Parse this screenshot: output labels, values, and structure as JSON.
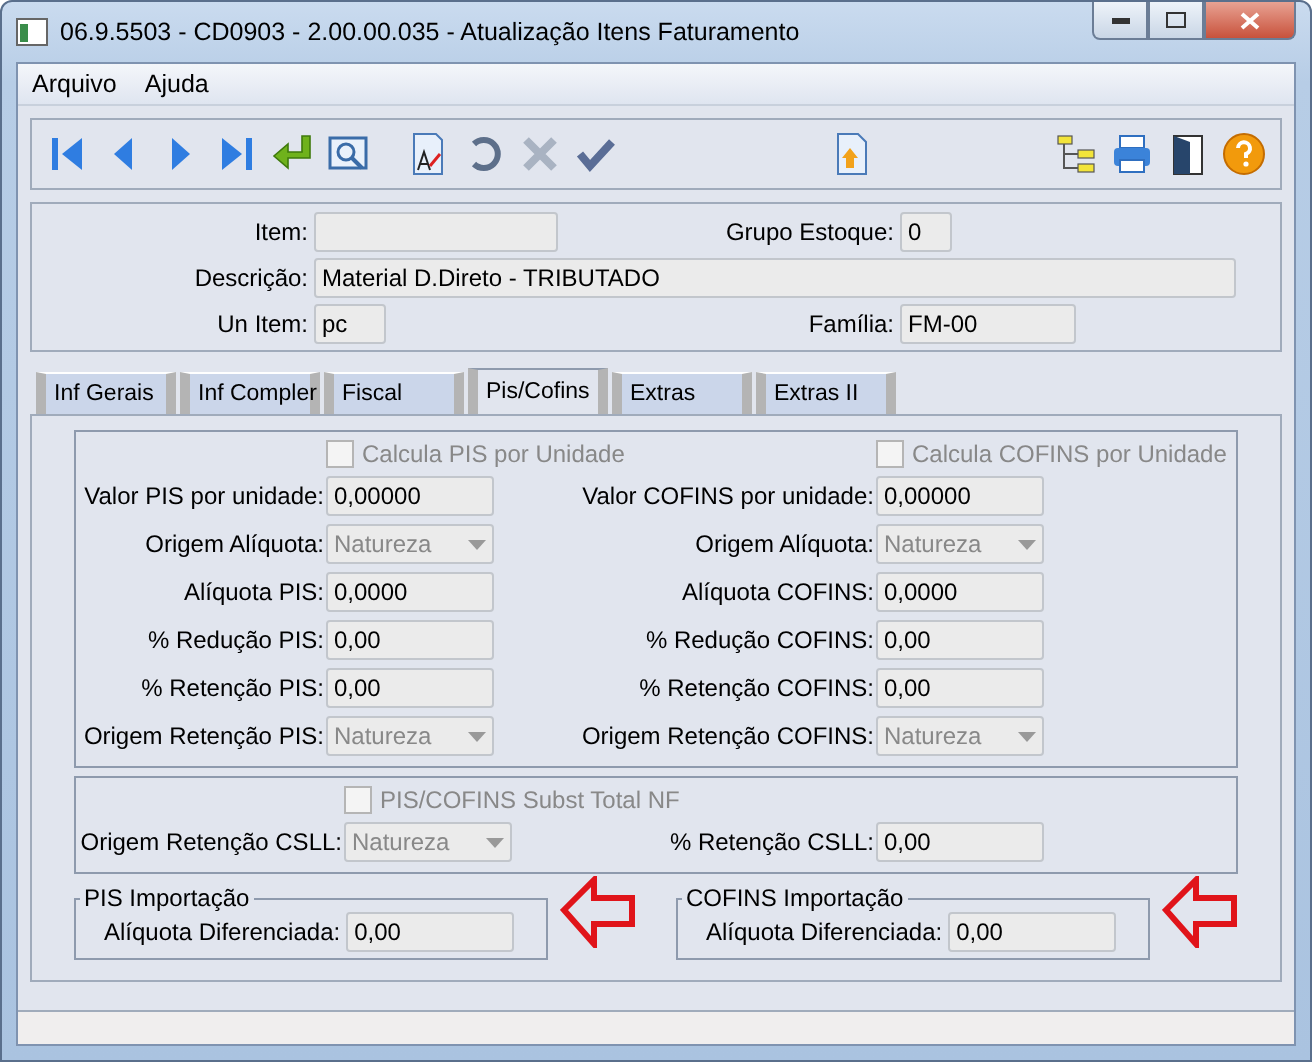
{
  "window": {
    "title": "06.9.5503 - CD0903 - 2.00.00.035 - Atualização Itens Faturamento"
  },
  "menu": [
    "Arquivo",
    "Ajuda"
  ],
  "header": {
    "item": {
      "label": "Item:"
    },
    "grupo_estoque": {
      "label": "Grupo Estoque:",
      "value": "0"
    },
    "descricao": {
      "label": "Descrição:",
      "value": "Material D.Direto - TRIBUTADO"
    },
    "un_item": {
      "label": "Un Item:",
      "value": "pc"
    },
    "familia": {
      "label": "Família:",
      "value": "FM-00"
    }
  },
  "tabs": [
    {
      "label": "Inf Gerais",
      "selected": false
    },
    {
      "label": "Inf Compler",
      "selected": false
    },
    {
      "label": "Fiscal",
      "selected": false
    },
    {
      "label": "Pis/Cofins",
      "selected": true
    },
    {
      "label": "Extras",
      "selected": false
    },
    {
      "label": "Extras II",
      "selected": false
    }
  ],
  "pis_cofins": {
    "checkboxes": [
      {
        "label": "Calcula PIS por Unidade",
        "checked": false,
        "disabled": true
      },
      {
        "label": "Calcula COFINS por Unidade",
        "checked": false,
        "disabled": true
      }
    ],
    "rows": [
      {
        "left": {
          "label": "Valor PIS por unidade:",
          "kind": "text",
          "value": "0,00000"
        },
        "right": {
          "label": "Valor COFINS por unidade:",
          "kind": "text",
          "value": "0,00000"
        }
      },
      {
        "left": {
          "label": "Origem Alíquota:",
          "kind": "select",
          "value": "Natureza",
          "disabled": true
        },
        "right": {
          "label": "Origem Alíquota:",
          "kind": "select",
          "value": "Natureza",
          "disabled": true
        }
      },
      {
        "left": {
          "label": "Alíquota PIS:",
          "kind": "text",
          "value": "0,0000"
        },
        "right": {
          "label": "Alíquota COFINS:",
          "kind": "text",
          "value": "0,0000"
        }
      },
      {
        "left": {
          "label": "% Redução PIS:",
          "kind": "text",
          "value": "0,00"
        },
        "right": {
          "label": "% Redução COFINS:",
          "kind": "text",
          "value": "0,00"
        }
      },
      {
        "left": {
          "label": "% Retenção PIS:",
          "kind": "text",
          "value": "0,00"
        },
        "right": {
          "label": "% Retenção COFINS:",
          "kind": "text",
          "value": "0,00"
        }
      },
      {
        "left": {
          "label": "Origem Retenção PIS:",
          "kind": "select",
          "value": "Natureza",
          "disabled": true
        },
        "right": {
          "label": "Origem Retenção COFINS:",
          "kind": "select",
          "value": "Natureza",
          "disabled": true
        }
      }
    ]
  },
  "csll": {
    "checkbox": {
      "label": "PIS/COFINS Subst Total NF",
      "checked": false,
      "disabled": true
    },
    "left": {
      "label": "Origem Retenção CSLL:",
      "kind": "select",
      "value": "Natureza",
      "disabled": true
    },
    "right": {
      "label": "% Retenção CSLL:",
      "kind": "text",
      "value": "0,00"
    }
  },
  "importacao": [
    {
      "title": "PIS Importação",
      "label": "Alíquota Diferenciada:",
      "value": "0,00"
    },
    {
      "title": "COFINS Importação",
      "label": "Alíquota Diferenciada:",
      "value": "0,00"
    }
  ]
}
